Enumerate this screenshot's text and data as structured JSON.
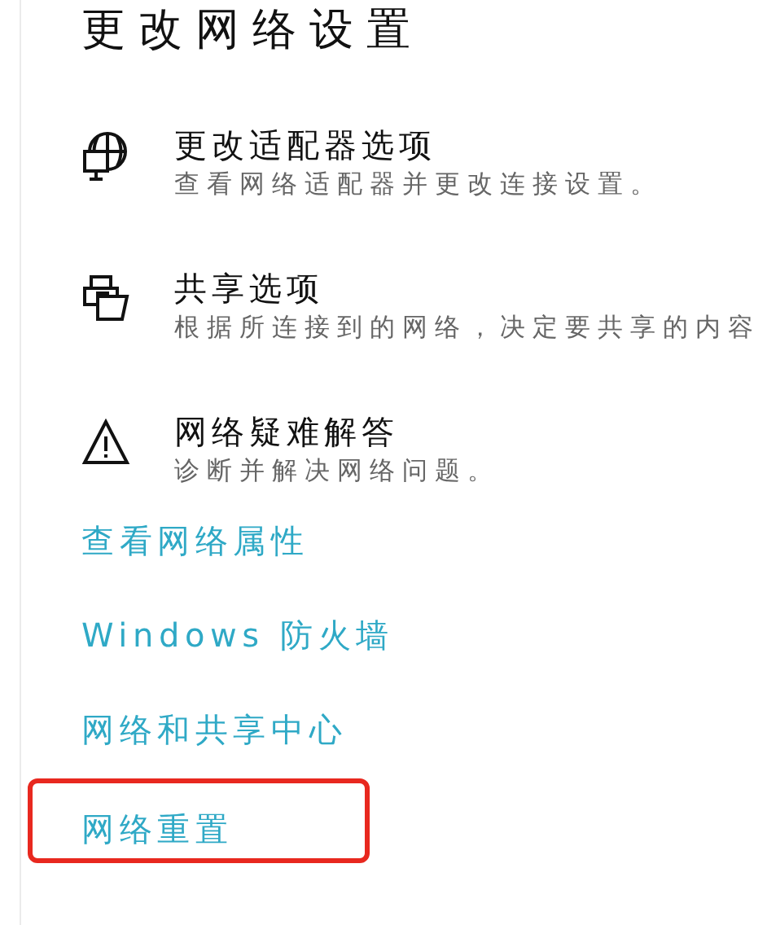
{
  "title": "更改网络设置",
  "options": [
    {
      "kind": "adapter",
      "title": "更改适配器选项",
      "description": "查看网络适配器并更改连接设置。"
    },
    {
      "kind": "sharing",
      "title": "共享选项",
      "description": "根据所连接到的网络，决定要共享的内容"
    },
    {
      "kind": "troubleshoot",
      "title": "网络疑难解答",
      "description": "诊断并解决网络问题。"
    }
  ],
  "links": [
    {
      "label": "查看网络属性",
      "highlighted": false
    },
    {
      "label": "Windows 防火墙",
      "highlighted": false
    },
    {
      "label": "网络和共享中心",
      "highlighted": false
    },
    {
      "label": "网络重置",
      "highlighted": true
    }
  ]
}
